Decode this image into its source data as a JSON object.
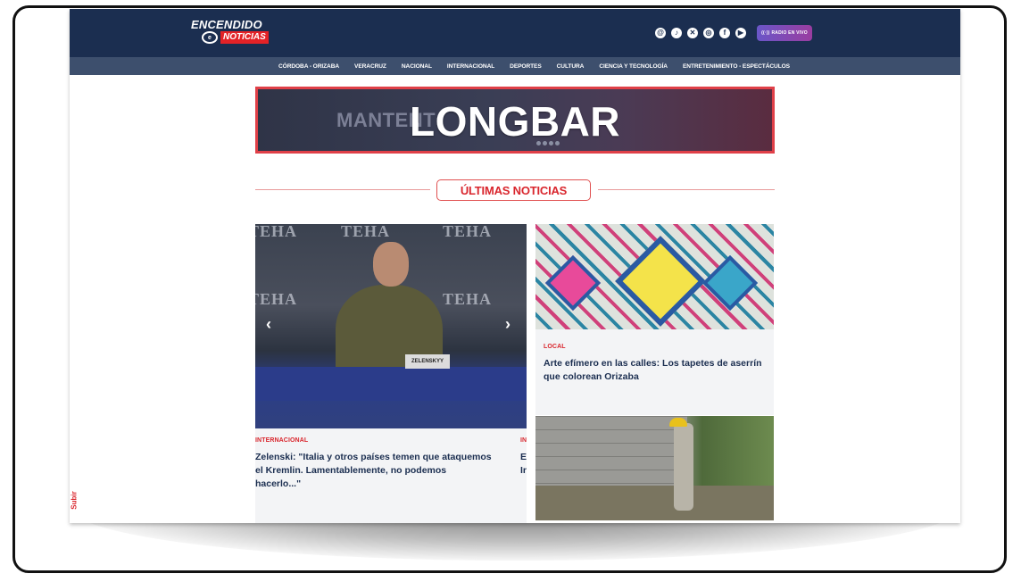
{
  "header": {
    "logo_top": "ENCENDIDO",
    "logo_sub": "NOTICIAS",
    "logo_mark": "e",
    "social_icons": [
      "threads-icon",
      "tiktok-icon",
      "x-icon",
      "instagram-icon",
      "facebook-icon",
      "youtube-icon"
    ],
    "radio_label": "RADIO EN VIVO"
  },
  "nav": {
    "items": [
      "CÓRDOBA - ORIZABA",
      "VERACRUZ",
      "NACIONAL",
      "INTERNACIONAL",
      "DEPORTES",
      "CULTURA",
      "CIENCIA Y TECNOLOGÍA",
      "ENTRETENIMIENTO - ESPECTÁCULOS"
    ]
  },
  "banner": {
    "faint_text": "MANTENT",
    "label": "LONGBAR"
  },
  "section": {
    "title": "ÚLTIMAS NOTICIAS"
  },
  "main_story": {
    "backdrop_text": "TEHA",
    "nameplate": "ZELENSKYY",
    "category": "INTERNACIONAL",
    "title": "Zelenski: \"Italia y otros países temen que ataquemos el Kremlin. Lamentablemente, no podemos hacerlo...\"",
    "next_peek_cat": "IN",
    "next_peek_line1": "E",
    "next_peek_line2": "Ir"
  },
  "card2": {
    "category": "LOCAL",
    "title": "Arte efímero en las calles: Los tapetes de aserrín que colorean Orizaba"
  },
  "side": {
    "subir": "Subir"
  },
  "colors": {
    "header_bg": "#1b2e50",
    "nav_bg": "#3d4f6d",
    "accent_red": "#d9262d"
  }
}
